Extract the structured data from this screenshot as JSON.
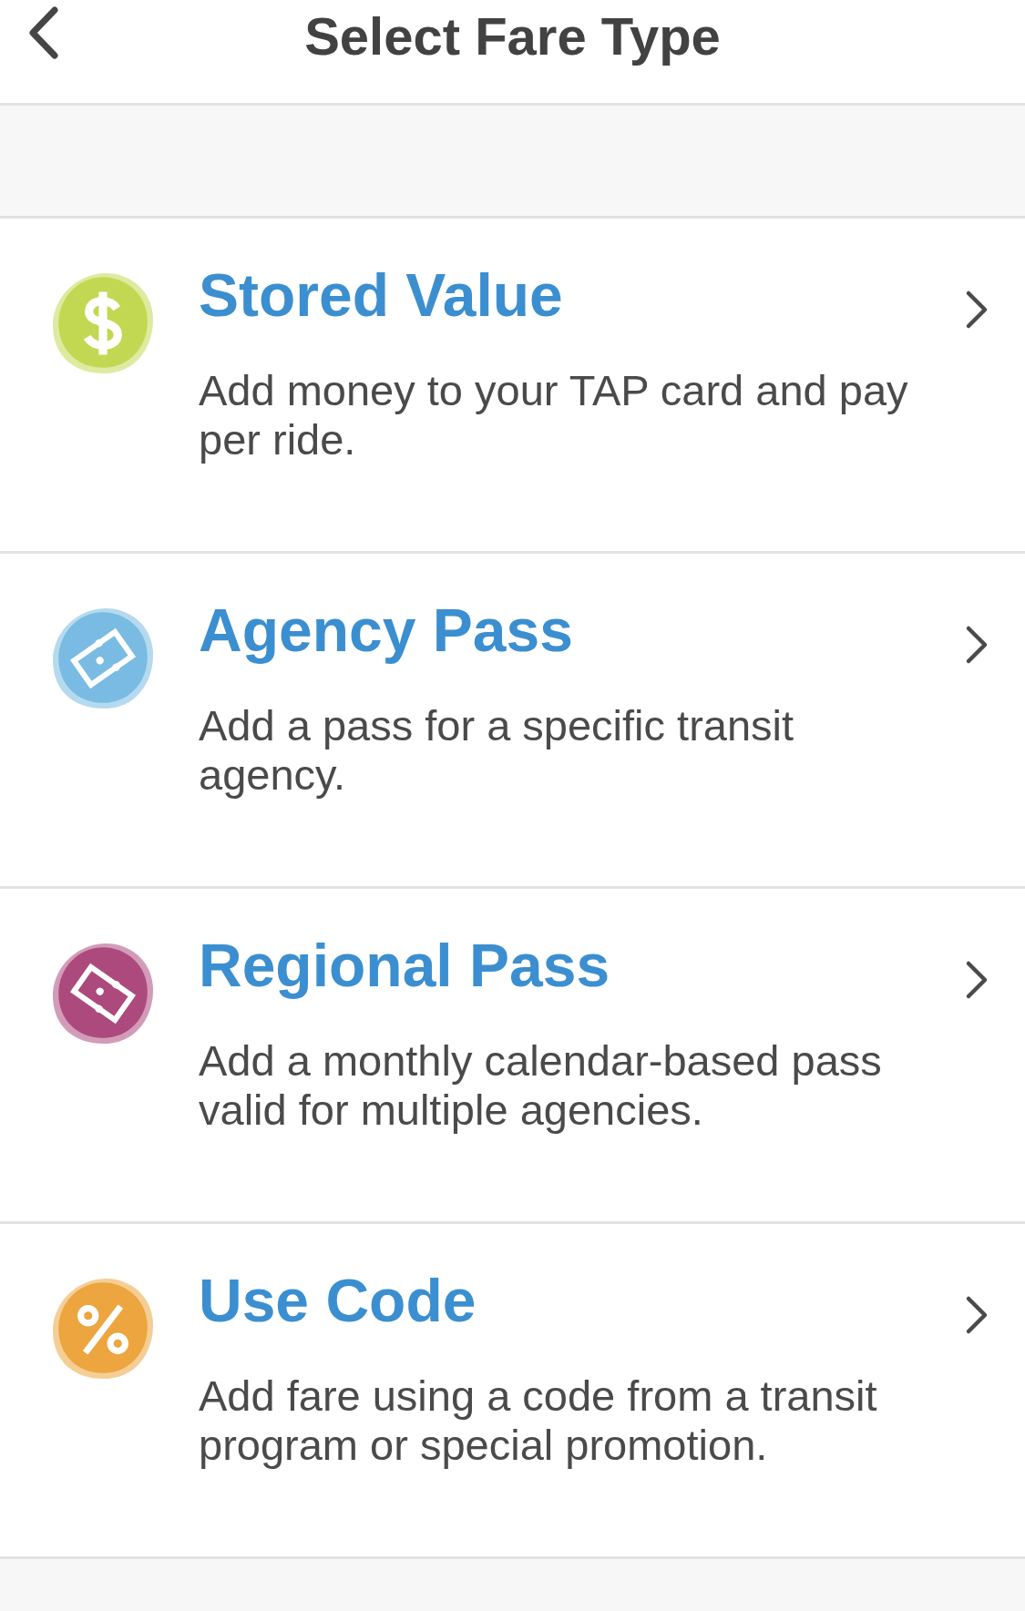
{
  "header": {
    "title": "Select Fare Type"
  },
  "fare_types": [
    {
      "kind": "stored",
      "color": "#c3d852",
      "title": "Stored Value",
      "description": "Add money to your TAP card and pay per ride."
    },
    {
      "kind": "agency",
      "color": "#79bbe2",
      "title": "Agency Pass",
      "description": "Add a pass for a specific transit agency."
    },
    {
      "kind": "regional",
      "color": "#ad4a7d",
      "title": "Regional Pass",
      "description": "Add a monthly calendar-based pass valid for multiple agencies."
    },
    {
      "kind": "code",
      "color": "#eca53f",
      "title": "Use Code",
      "description": "Add fare using a code from a transit program or special promotion."
    }
  ]
}
